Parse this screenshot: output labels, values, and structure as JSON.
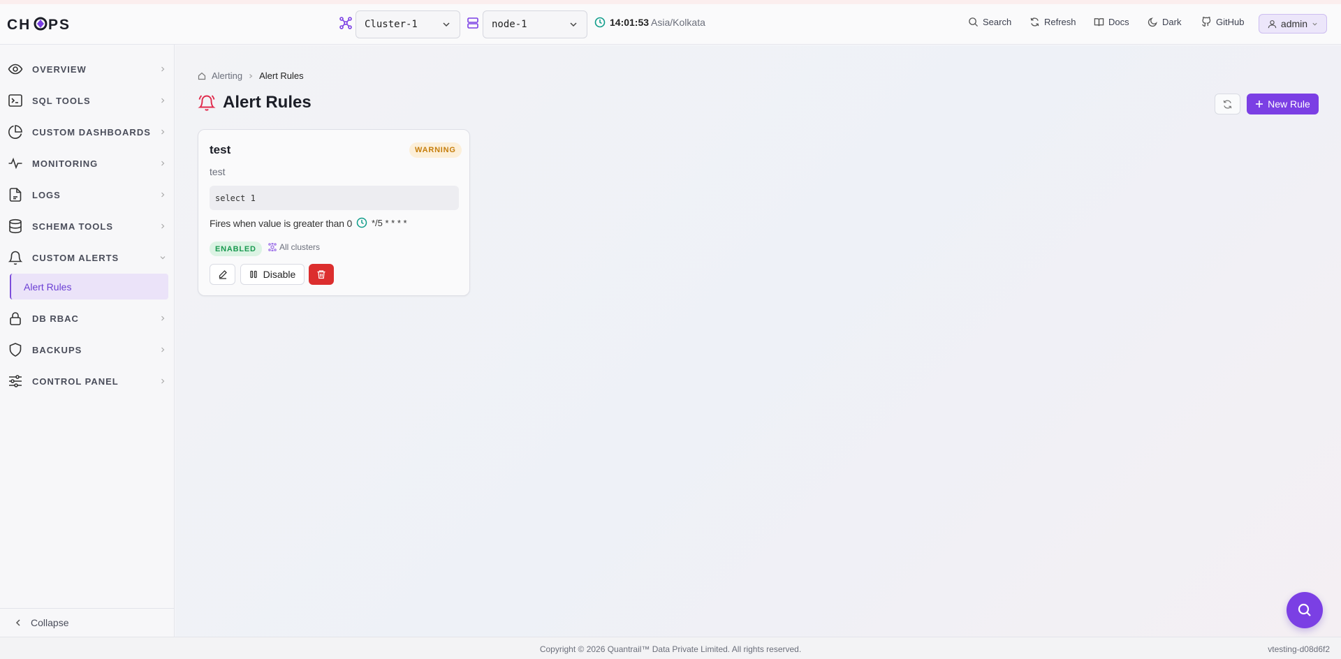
{
  "header": {
    "brand": "CHOPS",
    "cluster_select": {
      "value": "Cluster-1"
    },
    "node_select": {
      "value": "node-1"
    },
    "clock": {
      "time": "14:01:53",
      "timezone": "Asia/Kolkata"
    },
    "actions": [
      {
        "label": "Search",
        "icon": "search-icon"
      },
      {
        "label": "Refresh",
        "icon": "refresh-icon"
      },
      {
        "label": "Docs",
        "icon": "book-icon"
      },
      {
        "label": "Dark",
        "icon": "moon-icon"
      },
      {
        "label": "GitHub",
        "icon": "github-icon"
      }
    ],
    "user": {
      "label": "admin"
    }
  },
  "sidebar": {
    "items": [
      {
        "label": "OVERVIEW",
        "icon": "eye-icon"
      },
      {
        "label": "SQL TOOLS",
        "icon": "terminal-icon"
      },
      {
        "label": "CUSTOM DASHBOARDS",
        "icon": "pie-chart-icon"
      },
      {
        "label": "MONITORING",
        "icon": "activity-icon"
      },
      {
        "label": "LOGS",
        "icon": "file-log-icon"
      },
      {
        "label": "SCHEMA TOOLS",
        "icon": "database-icon"
      },
      {
        "label": "CUSTOM ALERTS",
        "icon": "bell-icon"
      },
      {
        "label": "DB RBAC",
        "icon": "lock-icon"
      },
      {
        "label": "BACKUPS",
        "icon": "shield-icon"
      },
      {
        "label": "CONTROL PANEL",
        "icon": "sliders-icon"
      }
    ],
    "active_subitem": "Alert Rules",
    "collapse_label": "Collapse"
  },
  "page": {
    "breadcrumb": {
      "parent": "Alerting",
      "current": "Alert Rules"
    },
    "title": "Alert Rules",
    "new_rule_label": "New Rule"
  },
  "rule_card": {
    "name": "test",
    "severity": "WARNING",
    "description": "test",
    "query": "select 1",
    "condition": "Fires when value is greater than 0",
    "schedule": "*/5 * * * *",
    "status": "ENABLED",
    "scope": "All clusters",
    "disable_label": "Disable"
  },
  "footer": {
    "copyright": "Copyright © 2026 Quantrail™ Data Private Limited. All rights reserved.",
    "version": "vtesting-d08d6f2"
  },
  "colors": {
    "accent": "#7b3fe4",
    "danger": "#dc2e2e",
    "warning": "#c57d0b",
    "success": "#1a9a50"
  }
}
